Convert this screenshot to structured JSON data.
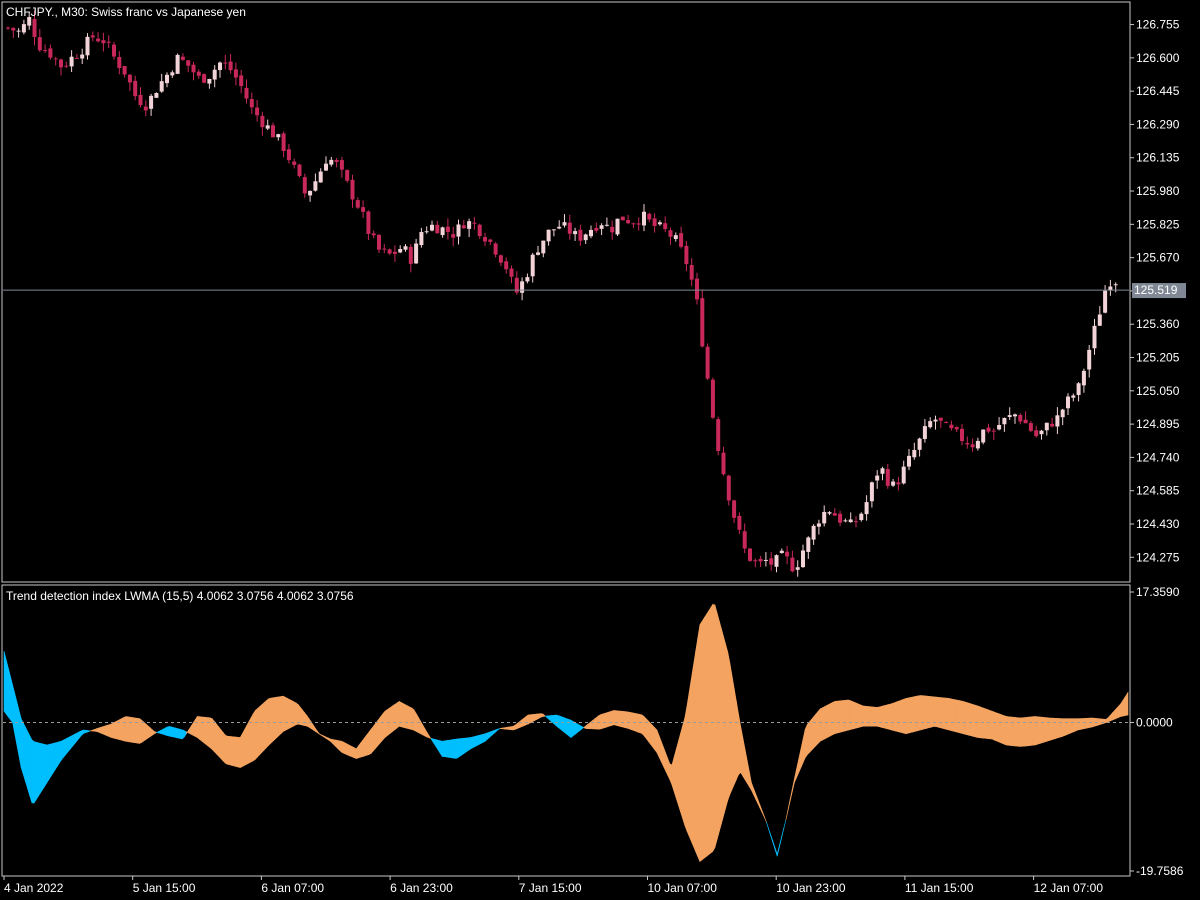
{
  "header": {
    "symbol_title": "CHFJPY., M30:  Swiss franc vs Japanese yen",
    "indicator_title": "Trend detection index LWMA (15,5) 4.0062 3.0756 4.0062 3.0756"
  },
  "colors": {
    "background": "#000000",
    "frame": "#c8c8c8",
    "candle_up": "#f2d4d8",
    "candle_down": "#c8285a",
    "price_line": "#7f8894",
    "price_tag_bg": "#7f8894",
    "fill_positive": "#f4a460",
    "fill_negative": "#00bfff",
    "zero_line": "#9a9a9a"
  },
  "chart_data": [
    {
      "type": "candlestick",
      "title": "CHFJPY., M30:  Swiss franc vs Japanese yen",
      "ylim": [
        124.16,
        126.86
      ],
      "y_ticks": [
        "126.755",
        "126.600",
        "126.445",
        "126.290",
        "126.135",
        "125.980",
        "125.825",
        "125.670",
        "125.515",
        "125.360",
        "125.205",
        "125.050",
        "124.895",
        "124.740",
        "124.585",
        "124.430",
        "124.275"
      ],
      "x_ticks": [
        "4 Jan 2022",
        "5 Jan 15:00",
        "6 Jan 07:00",
        "6 Jan 23:00",
        "7 Jan 15:00",
        "10 Jan 07:00",
        "10 Jan 23:00",
        "11 Jan 15:00",
        "12 Jan 07:00"
      ],
      "current_price": "125.519",
      "close_path": [
        [
          0,
          126.74
        ],
        [
          8,
          126.72
        ],
        [
          15,
          126.78
        ],
        [
          22,
          126.66
        ],
        [
          30,
          126.62
        ],
        [
          38,
          126.56
        ],
        [
          45,
          126.6
        ],
        [
          52,
          126.64
        ],
        [
          60,
          126.7
        ],
        [
          68,
          126.68
        ],
        [
          75,
          126.6
        ],
        [
          82,
          126.54
        ],
        [
          90,
          126.42
        ],
        [
          98,
          126.38
        ],
        [
          105,
          126.46
        ],
        [
          112,
          126.52
        ],
        [
          120,
          126.6
        ],
        [
          128,
          126.56
        ],
        [
          135,
          126.5
        ],
        [
          142,
          126.52
        ],
        [
          150,
          126.58
        ],
        [
          158,
          126.54
        ],
        [
          165,
          126.46
        ],
        [
          172,
          126.36
        ],
        [
          180,
          126.3
        ],
        [
          188,
          126.24
        ],
        [
          195,
          126.18
        ],
        [
          202,
          126.08
        ],
        [
          210,
          125.96
        ],
        [
          218,
          126.04
        ],
        [
          225,
          126.14
        ],
        [
          232,
          126.1
        ],
        [
          240,
          126.0
        ],
        [
          248,
          125.9
        ],
        [
          255,
          125.78
        ],
        [
          262,
          125.7
        ],
        [
          270,
          125.68
        ],
        [
          278,
          125.72
        ],
        [
          285,
          125.66
        ],
        [
          292,
          125.8
        ],
        [
          300,
          125.82
        ],
        [
          308,
          125.8
        ],
        [
          315,
          125.78
        ],
        [
          322,
          125.84
        ],
        [
          330,
          125.82
        ],
        [
          338,
          125.76
        ],
        [
          345,
          125.7
        ],
        [
          352,
          125.62
        ],
        [
          358,
          125.5
        ],
        [
          365,
          125.58
        ],
        [
          372,
          125.7
        ],
        [
          380,
          125.78
        ],
        [
          388,
          125.82
        ],
        [
          395,
          125.8
        ],
        [
          402,
          125.76
        ],
        [
          410,
          125.8
        ],
        [
          418,
          125.84
        ],
        [
          425,
          125.8
        ],
        [
          432,
          125.86
        ],
        [
          440,
          125.84
        ],
        [
          448,
          125.86
        ],
        [
          455,
          125.82
        ],
        [
          462,
          125.8
        ],
        [
          470,
          125.76
        ],
        [
          478,
          125.66
        ],
        [
          485,
          125.5
        ],
        [
          488,
          125.36
        ],
        [
          492,
          125.18
        ],
        [
          496,
          124.98
        ],
        [
          500,
          124.82
        ],
        [
          505,
          124.66
        ],
        [
          510,
          124.52
        ],
        [
          515,
          124.4
        ],
        [
          520,
          124.3
        ],
        [
          525,
          124.26
        ],
        [
          530,
          124.24
        ],
        [
          535,
          124.26
        ],
        [
          540,
          124.24
        ],
        [
          545,
          124.28
        ],
        [
          550,
          124.26
        ],
        [
          555,
          124.22
        ],
        [
          560,
          124.3
        ],
        [
          565,
          124.36
        ],
        [
          570,
          124.44
        ],
        [
          575,
          124.48
        ],
        [
          580,
          124.5
        ],
        [
          585,
          124.46
        ],
        [
          590,
          124.44
        ],
        [
          595,
          124.42
        ],
        [
          600,
          124.46
        ],
        [
          605,
          124.52
        ],
        [
          610,
          124.62
        ],
        [
          615,
          124.7
        ],
        [
          620,
          124.64
        ],
        [
          625,
          124.6
        ],
        [
          630,
          124.66
        ],
        [
          635,
          124.72
        ],
        [
          640,
          124.78
        ],
        [
          645,
          124.84
        ],
        [
          650,
          124.9
        ],
        [
          655,
          124.92
        ],
        [
          660,
          124.88
        ],
        [
          665,
          124.86
        ],
        [
          670,
          124.84
        ],
        [
          675,
          124.82
        ],
        [
          680,
          124.8
        ],
        [
          685,
          124.84
        ],
        [
          690,
          124.88
        ],
        [
          695,
          124.86
        ],
        [
          700,
          124.9
        ],
        [
          705,
          124.92
        ],
        [
          710,
          124.94
        ],
        [
          715,
          124.92
        ],
        [
          720,
          124.88
        ],
        [
          725,
          124.84
        ],
        [
          730,
          124.86
        ],
        [
          735,
          124.9
        ],
        [
          740,
          124.92
        ],
        [
          745,
          124.98
        ],
        [
          750,
          125.02
        ],
        [
          755,
          125.06
        ],
        [
          760,
          125.18
        ],
        [
          765,
          125.3
        ],
        [
          770,
          125.42
        ],
        [
          775,
          125.55
        ],
        [
          780,
          125.58
        ],
        [
          785,
          125.52
        ]
      ]
    },
    {
      "type": "area",
      "title": "Trend detection index LWMA (15,5) 4.0062 3.0756 4.0062 3.0756",
      "ylim": [
        -19.7586,
        17.359
      ],
      "y_ticks": [
        "17.3590",
        "0.0000",
        "-19.7586"
      ],
      "series": [
        {
          "values": [
            [
              0,
              9.5
            ],
            [
              6,
              5
            ],
            [
              12,
              0.5
            ],
            [
              20,
              -2.5
            ],
            [
              30,
              -3
            ],
            [
              40,
              -2.5
            ],
            [
              55,
              -1
            ],
            [
              65,
              -1.2
            ],
            [
              75,
              -2
            ],
            [
              85,
              -2.5
            ],
            [
              95,
              -2.8
            ],
            [
              105,
              -1.5
            ],
            [
              115,
              -0.5
            ],
            [
              125,
              -1
            ],
            [
              135,
              -2
            ],
            [
              145,
              -3.5
            ],
            [
              155,
              -5.5
            ],
            [
              165,
              -6
            ],
            [
              175,
              -5
            ],
            [
              185,
              -3
            ],
            [
              195,
              -1.2
            ],
            [
              205,
              -0.2
            ],
            [
              212,
              -0.5
            ],
            [
              220,
              -1.5
            ],
            [
              228,
              -2.5
            ],
            [
              236,
              -4
            ],
            [
              246,
              -4.8
            ],
            [
              256,
              -4.2
            ],
            [
              266,
              -2
            ],
            [
              276,
              -0.5
            ],
            [
              286,
              -1
            ],
            [
              296,
              -2
            ],
            [
              306,
              -2.5
            ],
            [
              316,
              -2.2
            ],
            [
              326,
              -2
            ],
            [
              336,
              -1.5
            ],
            [
              346,
              -0.8
            ],
            [
              356,
              -1
            ],
            [
              366,
              -0.2
            ],
            [
              376,
              0.8
            ],
            [
              386,
              1
            ],
            [
              396,
              0.3
            ],
            [
              406,
              -0.8
            ],
            [
              416,
              -0.9
            ],
            [
              426,
              -0.3
            ],
            [
              436,
              -0.8
            ],
            [
              446,
              -1.5
            ],
            [
              456,
              -4
            ],
            [
              466,
              -8
            ],
            [
              476,
              -14
            ],
            [
              486,
              -18.5
            ],
            [
              496,
              -17
            ],
            [
              506,
              -10
            ],
            [
              514,
              -6.5
            ],
            [
              522,
              -9
            ],
            [
              532,
              -13
            ],
            [
              540,
              -17.5
            ],
            [
              546,
              -13
            ],
            [
              552,
              -8
            ],
            [
              560,
              -4.5
            ],
            [
              570,
              -2.5
            ],
            [
              580,
              -1.5
            ],
            [
              590,
              -1
            ],
            [
              600,
              -0.5
            ],
            [
              610,
              -0.5
            ],
            [
              620,
              -1
            ],
            [
              630,
              -1.5
            ],
            [
              640,
              -1
            ],
            [
              650,
              -0.5
            ],
            [
              660,
              -1
            ],
            [
              670,
              -1.5
            ],
            [
              680,
              -2
            ],
            [
              690,
              -2.2
            ],
            [
              700,
              -3
            ],
            [
              710,
              -3.2
            ],
            [
              720,
              -3
            ],
            [
              730,
              -2.4
            ],
            [
              740,
              -1.8
            ],
            [
              750,
              -1
            ],
            [
              760,
              -0.6
            ],
            [
              770,
              0
            ],
            [
              780,
              0.8
            ],
            [
              785,
              1
            ]
          ]
        },
        {
          "values": [
            [
              0,
              1.5
            ],
            [
              6,
              0
            ],
            [
              12,
              -6
            ],
            [
              20,
              -11
            ],
            [
              30,
              -8
            ],
            [
              40,
              -5
            ],
            [
              55,
              -1.5
            ],
            [
              65,
              -0.8
            ],
            [
              75,
              -0.2
            ],
            [
              85,
              0.8
            ],
            [
              95,
              0.5
            ],
            [
              105,
              -1.2
            ],
            [
              115,
              -1.8
            ],
            [
              125,
              -2.2
            ],
            [
              135,
              0.8
            ],
            [
              145,
              0.6
            ],
            [
              155,
              -1.8
            ],
            [
              165,
              -2
            ],
            [
              175,
              1.5
            ],
            [
              185,
              3.2
            ],
            [
              195,
              3.5
            ],
            [
              205,
              2.5
            ],
            [
              212,
              0.8
            ],
            [
              220,
              -1.5
            ],
            [
              228,
              -2.2
            ],
            [
              236,
              -2.5
            ],
            [
              246,
              -3.5
            ],
            [
              256,
              -1
            ],
            [
              266,
              1.5
            ],
            [
              276,
              2.8
            ],
            [
              286,
              1.8
            ],
            [
              296,
              -1.5
            ],
            [
              306,
              -4.5
            ],
            [
              316,
              -4.8
            ],
            [
              326,
              -3.5
            ],
            [
              336,
              -2.5
            ],
            [
              346,
              -0.8
            ],
            [
              356,
              -0.5
            ],
            [
              366,
              1
            ],
            [
              376,
              1.2
            ],
            [
              386,
              -0.5
            ],
            [
              396,
              -2
            ],
            [
              406,
              -0.5
            ],
            [
              416,
              1
            ],
            [
              426,
              1.6
            ],
            [
              436,
              1.4
            ],
            [
              446,
              1
            ],
            [
              456,
              -1
            ],
            [
              466,
              -6
            ],
            [
              476,
              1
            ],
            [
              486,
              13
            ],
            [
              496,
              16
            ],
            [
              506,
              9
            ],
            [
              514,
              0
            ],
            [
              522,
              -8
            ],
            [
              532,
              -13
            ],
            [
              540,
              -17.8
            ],
            [
              546,
              -13
            ],
            [
              552,
              -7.5
            ],
            [
              560,
              -0.5
            ],
            [
              570,
              1.8
            ],
            [
              580,
              2.8
            ],
            [
              590,
              3
            ],
            [
              600,
              2.2
            ],
            [
              610,
              2
            ],
            [
              620,
              2.5
            ],
            [
              630,
              3.2
            ],
            [
              640,
              3.6
            ],
            [
              650,
              3.4
            ],
            [
              660,
              3.2
            ],
            [
              670,
              2.8
            ],
            [
              680,
              2.2
            ],
            [
              690,
              1.5
            ],
            [
              700,
              0.8
            ],
            [
              710,
              0.6
            ],
            [
              720,
              0.8
            ],
            [
              730,
              0.6
            ],
            [
              740,
              0.5
            ],
            [
              750,
              0.5
            ],
            [
              760,
              0.6
            ],
            [
              770,
              0.4
            ],
            [
              780,
              2.5
            ],
            [
              785,
              4
            ]
          ]
        }
      ]
    }
  ]
}
